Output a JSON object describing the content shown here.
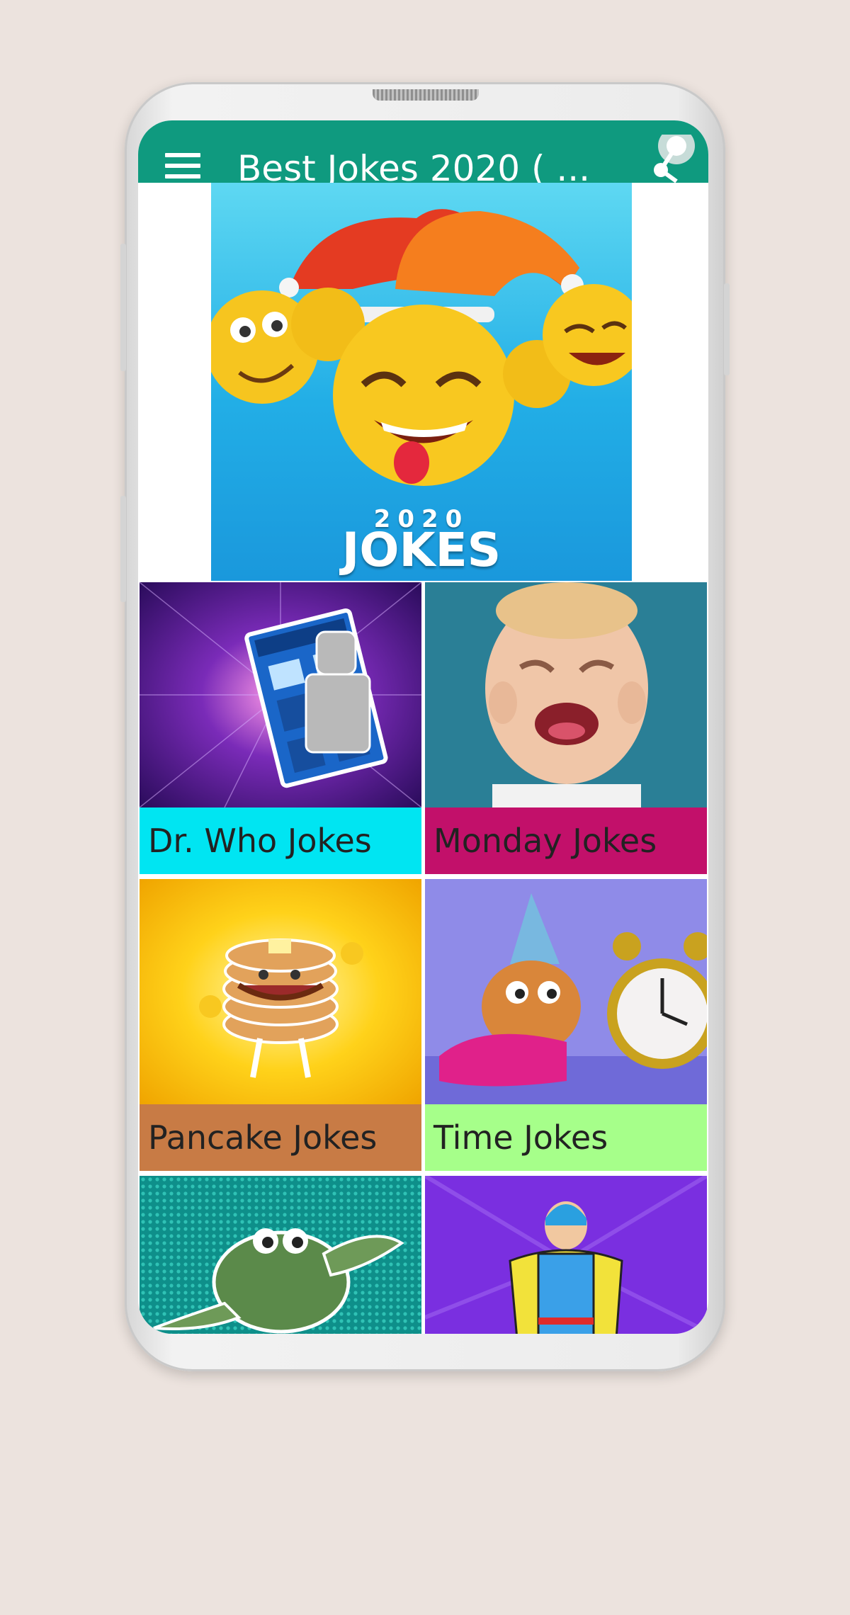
{
  "app": {
    "title": "Best Jokes 2020 ( ...",
    "theme_color": "#0f9a7f",
    "menu_icon": "hamburger-menu-icon",
    "share_icon": "share-icon"
  },
  "banner": {
    "year": "2020",
    "word": "JOKES"
  },
  "categories": [
    {
      "label": "Dr. Who Jokes",
      "color": "#00e5f2",
      "image": "tardis-robot"
    },
    {
      "label": "Monday Jokes",
      "color": "#c2106a",
      "image": "crying-baby"
    },
    {
      "label": "Pancake Jokes",
      "color": "#c87b45",
      "image": "pancake-stack"
    },
    {
      "label": "Time Jokes",
      "color": "#a6ff8a",
      "image": "dog-with-clock"
    },
    {
      "label": "",
      "color": "",
      "image": "turtle"
    },
    {
      "label": "",
      "color": "",
      "image": "superhero"
    }
  ]
}
